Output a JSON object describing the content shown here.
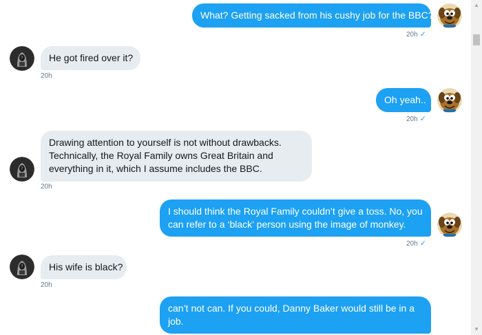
{
  "messages": [
    {
      "text": "What? Getting sacked from his cushy job for the BBC?",
      "time": "20h",
      "check": "✓"
    },
    {
      "text": "He got fired over it?",
      "time": "20h"
    },
    {
      "text": "Oh yeah..",
      "time": "20h",
      "check": "✓"
    },
    {
      "lines": [
        "Drawing attention to yourself is not without drawbacks.",
        "Technically, the Royal Family owns Great Britain and",
        "everything in it, which I assume includes the BBC."
      ],
      "time": "20h"
    },
    {
      "lines": [
        "I should think the Royal Family couldn’t give a toss. No, you",
        "can refer to a ‘black’ person using the image of monkey."
      ],
      "time": "20h",
      "check": "✓"
    },
    {
      "text": "His wife is black?",
      "time": "20h"
    },
    {
      "lines": [
        "can’t not can. If you could, Danny Baker would still be in a",
        "job."
      ]
    }
  ],
  "icons": {
    "sender_avatar": "cartoon-dog-avatar-icon",
    "receiver_avatar": "hooded-figure-avatar-icon",
    "read_receipt": "checkmark-icon"
  },
  "colors": {
    "sent_bubble": "#1da1f2",
    "received_bubble": "#e6ecf0",
    "timestamp": "#657786"
  },
  "scrollbar": {
    "up_arrow": "▲",
    "down_arrow": "▼"
  }
}
